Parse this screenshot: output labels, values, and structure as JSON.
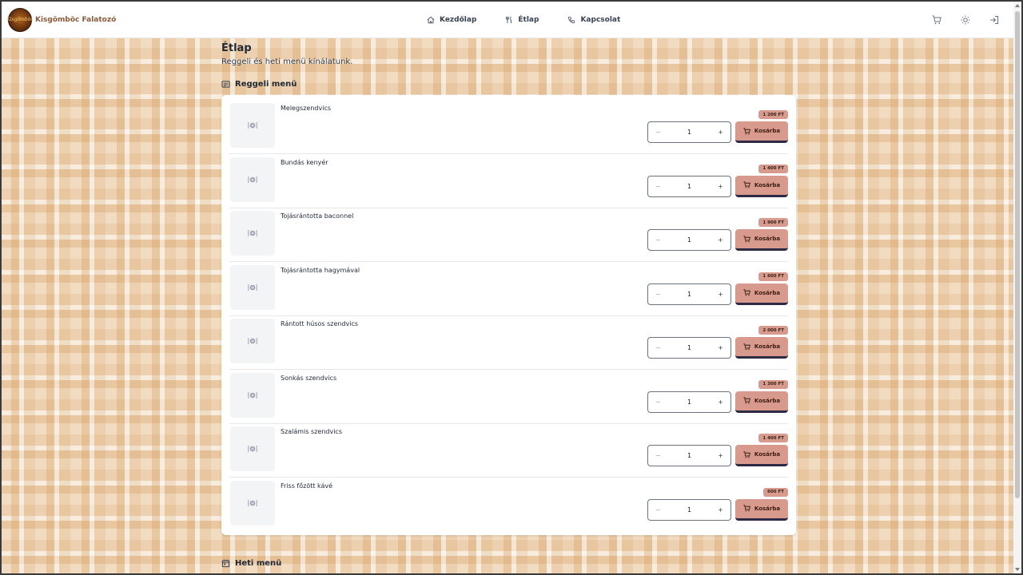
{
  "brand": {
    "name": "Kisgömböc Falatozó",
    "logo_text": "Kisgömböc"
  },
  "nav": {
    "links": [
      {
        "label": "Kezdőlap",
        "icon": "home-icon"
      },
      {
        "label": "Étlap",
        "icon": "utensils-icon"
      },
      {
        "label": "Kapcsolat",
        "icon": "phone-icon"
      }
    ],
    "actions": [
      "cart-icon",
      "sun-icon",
      "login-icon"
    ]
  },
  "page": {
    "title": "Étlap",
    "subtitle": "Reggeli és heti menü kínálatunk."
  },
  "sections": {
    "breakfast": {
      "title": "Reggeli menü",
      "icon": "menu-book-icon"
    },
    "weekly": {
      "title": "Heti menü",
      "icon": "calendar-icon"
    }
  },
  "cart_label": "Kosárba",
  "items": [
    {
      "name": "Melegszendvics",
      "price": "1 200 FT",
      "qty": "1"
    },
    {
      "name": "Bundás kenyér",
      "price": "1 400 FT",
      "qty": "1"
    },
    {
      "name": "Tojásrántotta baconnel",
      "price": "1 900 FT",
      "qty": "1"
    },
    {
      "name": "Tojásrántotta hagymával",
      "price": "1 600 FT",
      "qty": "1"
    },
    {
      "name": "Rántott húsos szendvics",
      "price": "2 000 FT",
      "qty": "1"
    },
    {
      "name": "Sonkás szendvics",
      "price": "1 300 FT",
      "qty": "1"
    },
    {
      "name": "Szalámis szendvics",
      "price": "1 400 FT",
      "qty": "1"
    },
    {
      "name": "Friss főzött kávé",
      "price": "600 FT",
      "qty": "1"
    }
  ],
  "stepper": {
    "minus": "−",
    "plus": "+"
  },
  "colors": {
    "accent": "#d79a8c",
    "button_border": "#2f2a44",
    "brand_text": "#8a5a3b"
  }
}
